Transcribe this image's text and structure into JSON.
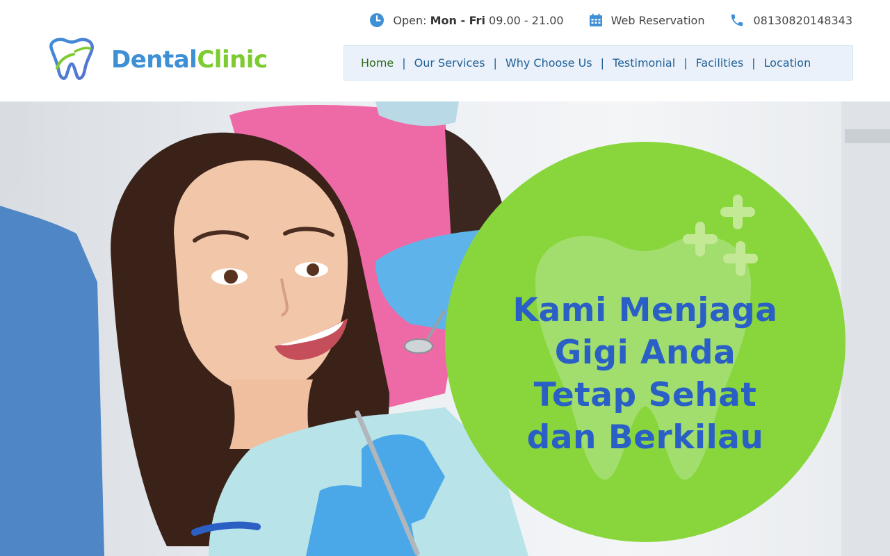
{
  "topbar": {
    "hours_prefix": "Open:",
    "hours_days": "Mon - Fri",
    "hours_time": "09.00 - 21.00",
    "reservation": "Web Reservation",
    "phone": "08130820148343",
    "icons": [
      "clock-icon",
      "calendar-icon",
      "phone-icon"
    ]
  },
  "brand": {
    "name_part1": "Dental",
    "name_part2": "Clinic",
    "colors": {
      "blue": "#3d8fd6",
      "green": "#7ccb2f"
    }
  },
  "nav": {
    "items": [
      {
        "label": "Home",
        "active": true
      },
      {
        "label": "Our Services"
      },
      {
        "label": "Why Choose Us"
      },
      {
        "label": "Testimonial"
      },
      {
        "label": "Facilities"
      },
      {
        "label": "Location"
      }
    ],
    "separator": "|"
  },
  "hero": {
    "headline_lines": [
      "Kami Menjaga",
      "Gigi Anda",
      "Tetap Sehat",
      "dan Berkilau"
    ],
    "colors": {
      "bubble": "#88d63c",
      "headline": "#2a5fc6"
    }
  }
}
